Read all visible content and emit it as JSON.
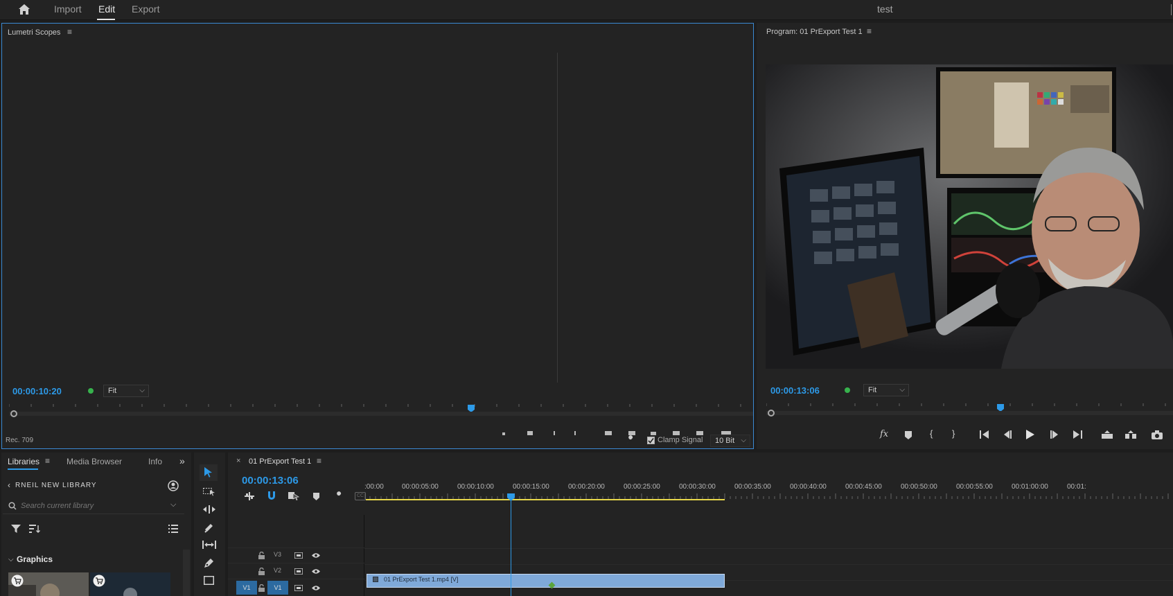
{
  "topbar": {
    "nav": [
      "Import",
      "Edit",
      "Export"
    ],
    "active": "Edit",
    "project_title": "test"
  },
  "lumetri": {
    "title": "Lumetri Scopes",
    "timecode": "00:00:10:20",
    "fit_label": "Fit",
    "colorspace": "Rec. 709",
    "clamp_label": "Clamp Signal",
    "bit_depth": "10 Bit"
  },
  "program": {
    "title": "Program: 01 PrExport Test 1",
    "timecode": "00:00:13:06",
    "fit_label": "Fit"
  },
  "libraries": {
    "tabs": [
      "Libraries",
      "Media Browser",
      "Info"
    ],
    "library_name": "RNEIL NEW LIBRARY",
    "search_placeholder": "Search current library",
    "section": "Graphics"
  },
  "timeline": {
    "tab_title": "01 PrExport Test 1",
    "timecode": "00:00:13:06",
    "ruler": [
      ":00:00",
      "00:00:05:00",
      "00:00:10:00",
      "00:00:15:00",
      "00:00:20:00",
      "00:00:25:00",
      "00:00:30:00",
      "00:00:35:00",
      "00:00:40:00",
      "00:00:45:00",
      "00:00:50:00",
      "00:00:55:00",
      "00:01:00:00",
      "00:01:"
    ],
    "tracks": [
      {
        "name": "V3",
        "source": ""
      },
      {
        "name": "V2",
        "source": ""
      },
      {
        "name": "V1",
        "source": "V1"
      }
    ],
    "clip_name": "01 PrExport Test 1.mp4 [V]"
  },
  "colors": {
    "accent_blue": "#2d9ae8",
    "clip_blue": "#7fa9d9",
    "work_area_yellow": "#e8d84a",
    "track_target_blue": "#2c6aa0"
  }
}
